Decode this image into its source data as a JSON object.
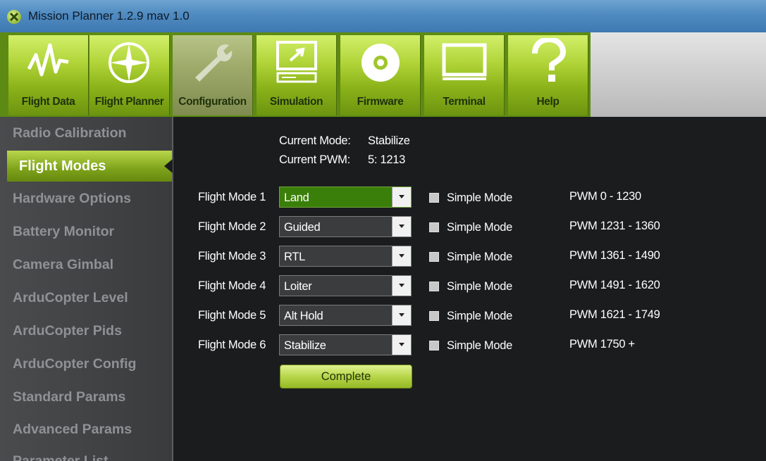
{
  "window": {
    "title": "Mission Planner 1.2.9 mav 1.0"
  },
  "toolbar": {
    "buttons": [
      {
        "label": "Flight Data",
        "icon": "flight-data-icon"
      },
      {
        "label": "Flight Planner",
        "icon": "compass-icon"
      },
      {
        "label": "Configuration",
        "icon": "wrench-icon",
        "active": true
      },
      {
        "label": "Simulation",
        "icon": "simulation-computer-icon"
      },
      {
        "label": "Firmware",
        "icon": "disc-icon"
      },
      {
        "label": "Terminal",
        "icon": "terminal-icon"
      },
      {
        "label": "Help",
        "icon": "question-mark-icon"
      }
    ]
  },
  "sidebar": {
    "items": [
      "Radio Calibration",
      "Flight Modes",
      "Hardware Options",
      "Battery Monitor",
      "Camera Gimbal",
      "ArduCopter Level",
      "ArduCopter Pids",
      "ArduCopter Config",
      "Standard Params",
      "Advanced Params",
      "Parameter List"
    ],
    "active_item": "Flight Modes"
  },
  "status": {
    "mode_label": "Current Mode:",
    "mode_value": "Stabilize",
    "pwm_label": "Current PWM:",
    "pwm_value": "5: 1213"
  },
  "modes": [
    {
      "label": "Flight Mode 1",
      "value": "Land",
      "simple": "Simple Mode",
      "pwm": "PWM 0 - 1230"
    },
    {
      "label": "Flight Mode 2",
      "value": "Guided",
      "simple": "Simple Mode",
      "pwm": "PWM 1231 - 1360"
    },
    {
      "label": "Flight Mode 3",
      "value": "RTL",
      "simple": "Simple Mode",
      "pwm": "PWM 1361 - 1490"
    },
    {
      "label": "Flight Mode 4",
      "value": "Loiter",
      "simple": "Simple Mode",
      "pwm": "PWM 1491 - 1620"
    },
    {
      "label": "Flight Mode 5",
      "value": "Alt Hold",
      "simple": "Simple Mode",
      "pwm": "PWM 1621 - 1749"
    },
    {
      "label": "Flight Mode 6",
      "value": "Stabilize",
      "simple": "Simple Mode",
      "pwm": "PWM 1750 +"
    }
  ],
  "actions": {
    "complete_label": "Complete"
  },
  "colors": {
    "accent_green": "#8bb319",
    "active_mode_green": "#3a7f09",
    "background": "#1b1c1e"
  }
}
